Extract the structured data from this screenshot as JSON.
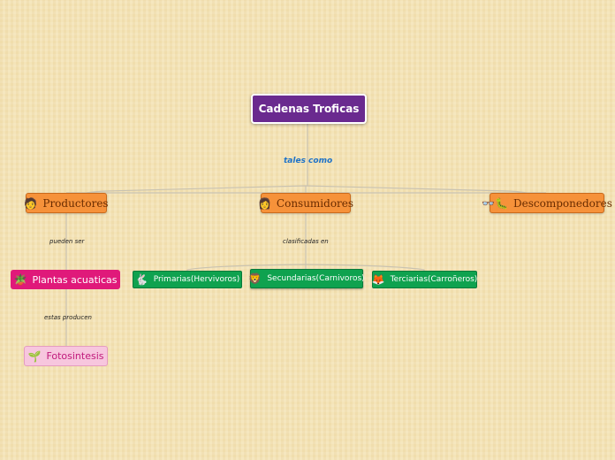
{
  "root": {
    "label": "Cadenas Troficas"
  },
  "links": {
    "tales_como": "tales como",
    "pueden_ser": "pueden ser",
    "clasificadas_en": "clasificadas en",
    "estas_producen": "estas producen"
  },
  "nodes": {
    "productores": {
      "label": "Productores",
      "icon": "person-icon"
    },
    "consumidores": {
      "label": "Consumidores",
      "icon": "woman-icon"
    },
    "descomponedores": {
      "label": "Descomponedores",
      "icon": "glasses-caterpillar-icon"
    },
    "plantas": {
      "label": "Plantas acuaticas",
      "icon": "potted-plant-icon"
    },
    "primarias": {
      "label": "Primarias(Hervivoros)",
      "icon": "rabbit-icon"
    },
    "secundarias": {
      "label": "Secundarias(Carnivoros)",
      "icon": "lion-icon"
    },
    "terciarias": {
      "label": "Terciarias(Carroñeros)",
      "icon": "fox-icon"
    },
    "fotosintesis": {
      "label": "Fotosintesis",
      "icon": "seedling-icon"
    }
  },
  "colors": {
    "root": "#6a2a8f",
    "orange": "#f6923a",
    "green": "#0fa24f",
    "pink": "#e0197a",
    "light_pink": "#f7c6de",
    "link_label": "#1d72c8"
  }
}
